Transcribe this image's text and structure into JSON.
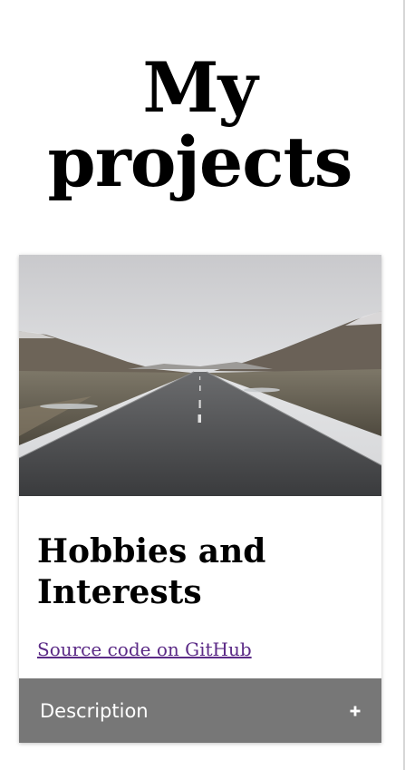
{
  "page": {
    "title": "My projects"
  },
  "project": {
    "image_subject": "empty-road-through-valley",
    "title": "Hobbies and Interests",
    "link_text": "Source code on GitHub",
    "accordion_label": "Description",
    "accordion_icon": "plus-icon"
  },
  "colors": {
    "link": "#5b2a86",
    "accordion_bg": "#777777",
    "accordion_text": "#ffffff"
  }
}
